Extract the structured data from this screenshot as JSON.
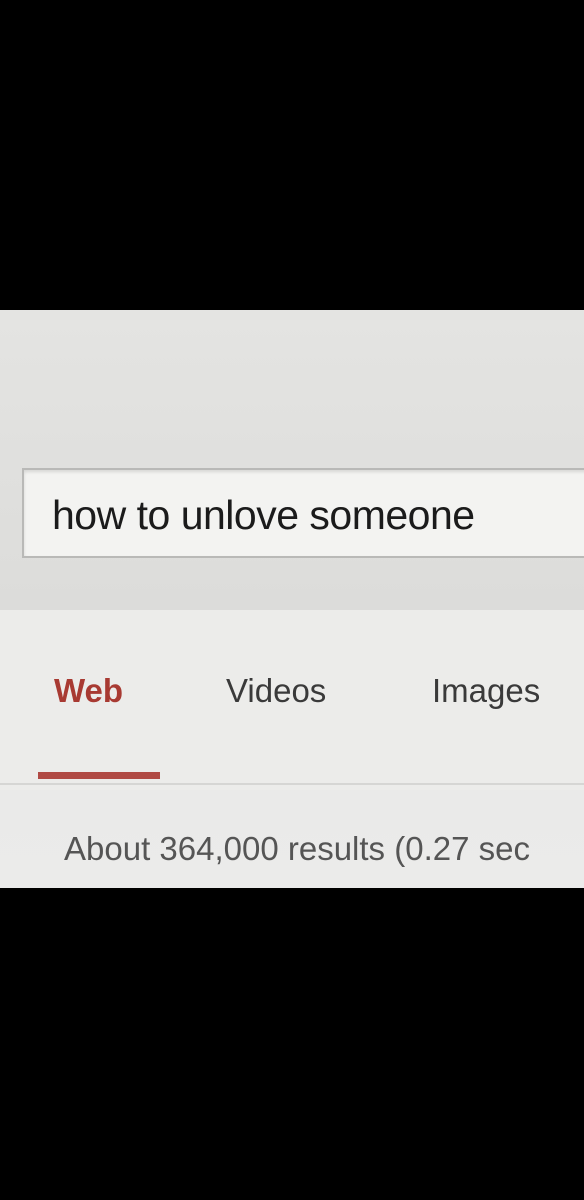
{
  "search": {
    "query": "how to unlove someone"
  },
  "tabs": [
    {
      "label": "Web",
      "active": true
    },
    {
      "label": "Videos",
      "active": false
    },
    {
      "label": "Images",
      "active": false
    }
  ],
  "results": {
    "stats": "About 364,000 results (0.27 sec"
  },
  "colors": {
    "active_tab": "#a83a32",
    "active_underline": "#b04a44"
  }
}
